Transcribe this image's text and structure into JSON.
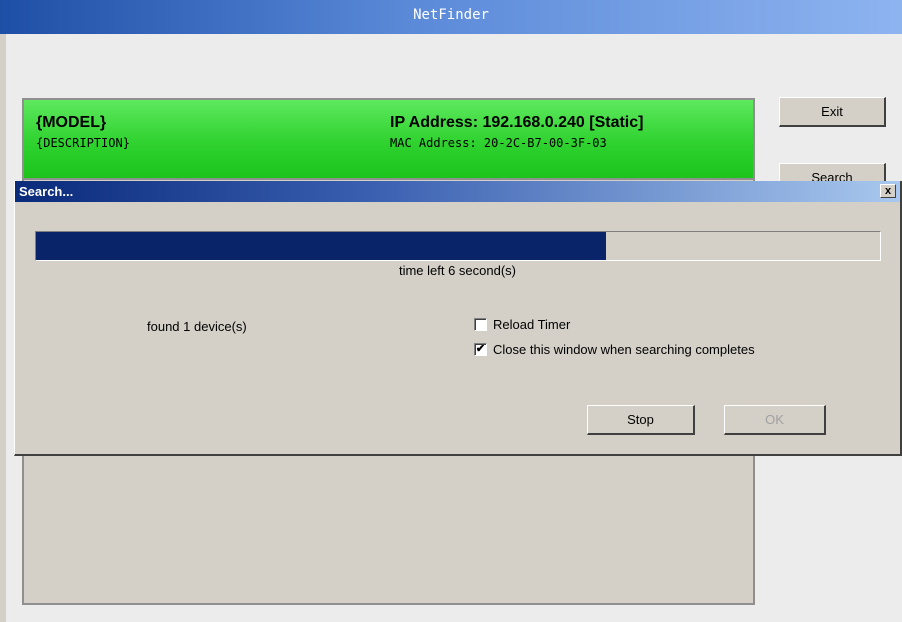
{
  "main_window": {
    "title": "NetFinder",
    "device": {
      "model": "{MODEL}",
      "description": "{DESCRIPTION}",
      "ip": "IP Address: 192.168.0.240 [Static]",
      "mac": "MAC Address: 20-2C-B7-00-3F-03"
    },
    "buttons": {
      "exit": "Exit",
      "search": "Search"
    }
  },
  "search_dialog": {
    "title": "Search...",
    "close_glyph": "x",
    "progress_fraction": 0.675,
    "time_left": "time left 6 second(s)",
    "found": "found 1 device(s)",
    "reload_timer": {
      "label": "Reload Timer",
      "checked": false
    },
    "close_when_done": {
      "label": "Close this window when searching completes",
      "checked": true
    },
    "stop_label": "Stop",
    "ok_label": "OK"
  },
  "colors": {
    "device_row": "#2fd22f",
    "progress": "#0a246a",
    "titlebar": "#1e4fa6"
  }
}
